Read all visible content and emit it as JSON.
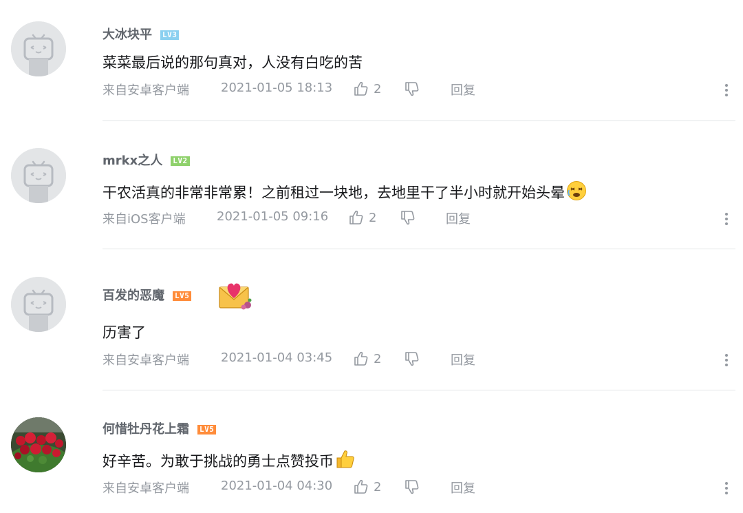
{
  "comments": [
    {
      "username": "大冰块平",
      "level": "LV3",
      "text": "菜菜最后说的那句真对，人没有白吃的苦",
      "source": "来自安卓客户端",
      "time": "2021-01-05 18:13",
      "likes": "2",
      "reply_label": "回复"
    },
    {
      "username": "mrkx之人",
      "level": "LV2",
      "text": "干农活真的非常非常累！之前租过一块地，去地里干了半小时就开始头晕",
      "emoji": "dizzy-face-emoji",
      "source": "来自iOS客户端",
      "time": "2021-01-05 09:16",
      "likes": "2",
      "reply_label": "回复"
    },
    {
      "username": "百发的恶魔",
      "level": "LV5",
      "sticker": "love-letter-sticker",
      "text": "历害了",
      "source": "来自安卓客户端",
      "time": "2021-01-04 03:45",
      "likes": "2",
      "reply_label": "回复"
    },
    {
      "username": "何惜牡丹花上霜",
      "level": "LV5",
      "avatar": "red-flowers-photo",
      "text": "好辛苦。为敢于挑战的勇士点赞投币",
      "emoji": "thumbs-up-emoji",
      "source": "来自安卓客户端",
      "time": "2021-01-04 04:30",
      "likes": "2",
      "reply_label": "回复"
    }
  ],
  "colors": {
    "username": "#61666d",
    "text": "#18191c",
    "meta": "#9499a0",
    "divider": "#e3e5e7",
    "lv2": "#8fd16c",
    "lv3": "#8bd0f0",
    "lv5": "#ff8c3a"
  }
}
